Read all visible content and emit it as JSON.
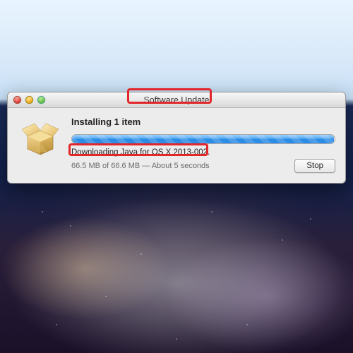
{
  "window": {
    "title": "Software Update",
    "heading": "Installing 1 item",
    "status": "Downloading Java for OS X 2013-002.",
    "detail": "66.5 MB of 66.6 MB — About 5 seconds",
    "stop_label": "Stop",
    "progress_percent": 99.8
  },
  "icons": {
    "package": "package-icon",
    "close": "close-traffic-light",
    "minimize": "minimize-traffic-light",
    "zoom": "zoom-traffic-light"
  },
  "colors": {
    "annotation": "#e2262a",
    "progress_blue": "#2d8de6"
  }
}
